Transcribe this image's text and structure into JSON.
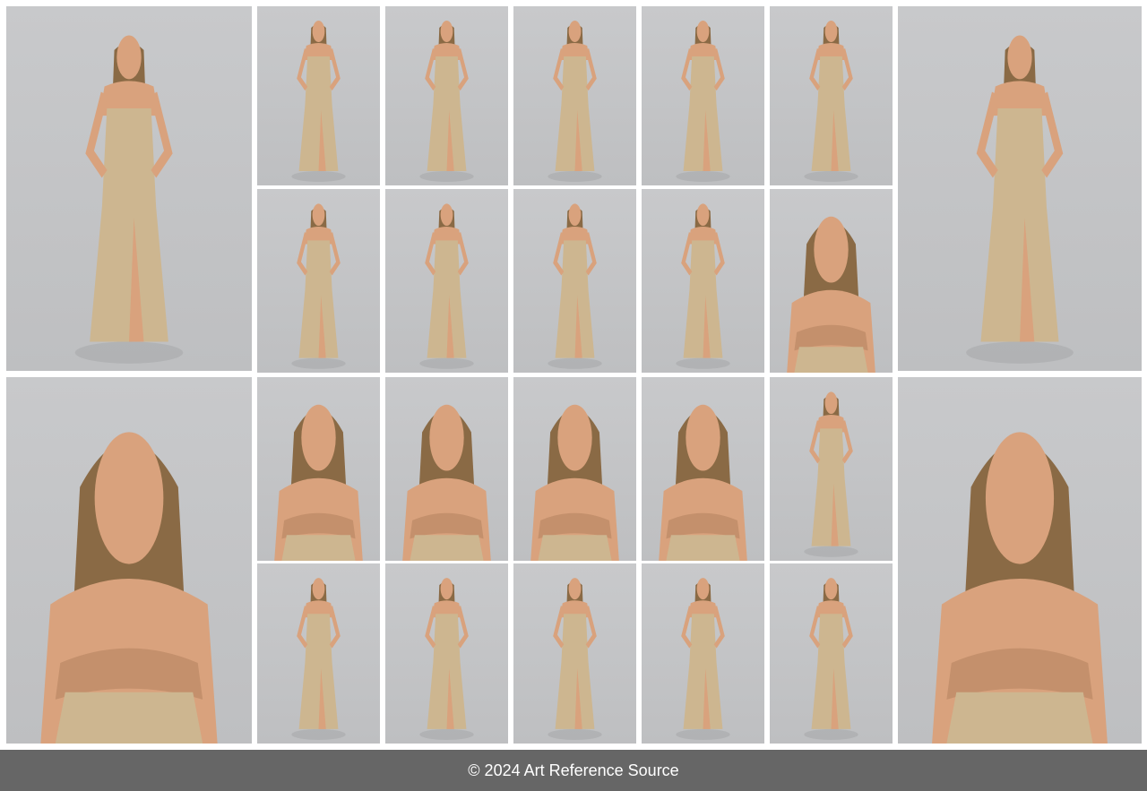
{
  "footer": {
    "copyright": "© 2024 Art Reference Source"
  },
  "colors": {
    "backdrop": "#c5c6c8",
    "dress": "#cdb690",
    "skin": "#d9a27d",
    "hair": "#8a6a45",
    "footer": "#666666"
  },
  "photos": [
    {
      "name": "photo-full-left-top",
      "pose": "full"
    },
    {
      "name": "photo-small-r1c1",
      "pose": "full"
    },
    {
      "name": "photo-small-r1c2",
      "pose": "full"
    },
    {
      "name": "photo-small-r1c3",
      "pose": "full"
    },
    {
      "name": "photo-small-r1c4",
      "pose": "full"
    },
    {
      "name": "photo-small-r1c5",
      "pose": "full"
    },
    {
      "name": "photo-full-right-top",
      "pose": "full"
    },
    {
      "name": "photo-small-r2c1",
      "pose": "full"
    },
    {
      "name": "photo-small-r2c2",
      "pose": "full"
    },
    {
      "name": "photo-small-r2c3",
      "pose": "full"
    },
    {
      "name": "photo-small-r2c4",
      "pose": "full"
    },
    {
      "name": "photo-small-r2c5",
      "pose": "bust"
    },
    {
      "name": "photo-portrait-left-bottom",
      "pose": "bust"
    },
    {
      "name": "photo-small-r3c1",
      "pose": "bust"
    },
    {
      "name": "photo-small-r3c2",
      "pose": "bust"
    },
    {
      "name": "photo-small-r3c3",
      "pose": "bust"
    },
    {
      "name": "photo-small-r3c4",
      "pose": "bust"
    },
    {
      "name": "photo-small-r3c5",
      "pose": "full"
    },
    {
      "name": "photo-portrait-right-bottom",
      "pose": "bust"
    },
    {
      "name": "photo-small-r4c1",
      "pose": "full"
    },
    {
      "name": "photo-small-r4c2",
      "pose": "full"
    },
    {
      "name": "photo-small-r4c3",
      "pose": "full"
    },
    {
      "name": "photo-small-r4c4",
      "pose": "full"
    },
    {
      "name": "photo-small-r4c5",
      "pose": "full"
    }
  ]
}
